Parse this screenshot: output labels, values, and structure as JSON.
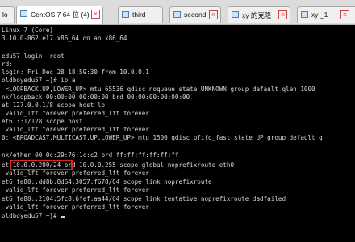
{
  "tabs": [
    {
      "label": "lo",
      "active": false
    },
    {
      "label": "CentOS 7 64 位 (4)",
      "active": true
    },
    {
      "label": "third",
      "active": false
    },
    {
      "label": "second",
      "active": false
    },
    {
      "label": "xy 的克隆",
      "active": false
    },
    {
      "label": "xy _1",
      "active": false
    }
  ],
  "tab_close_glyph": "×",
  "terminal": {
    "lines": [
      "Linux 7 (Core)",
      "3.10.0-862.el7.x86_64 on an x86_64",
      "",
      "edu57 login: root",
      "rd:",
      "login: Fri Dec 28 18:59:30 from 10.0.0.1",
      "oldboyedu57 ~]# ip a",
      " <LOOPBACK,UP,LOWER_UP> mtu 65536 qdisc noqueue state UNKNOWN group default qlen 1000",
      "nk/loopback 00:00:00:00:00:00 brd 00:00:00:00:00:00",
      "et 127.0.0.1/8 scope host lo",
      " valid_lft forever preferred_lft forever",
      "et6 ::1/128 scope host",
      " valid_lft forever preferred_lft forever",
      "0: <BROADCAST,MULTICAST,UP,LOWER_UP> mtu 1500 qdisc pfifo_fast state UP group default q",
      "",
      "nk/ether 00:0c:29:76:1c:c2 brd ff:ff:ff:ff:ff:ff",
      "et 10.0.0.200/24 brd 10.0.0.255 scope global noprefixroute eth0",
      " valid_lft forever preferred_lft forever",
      "et6 fe80::dd8b:8d64:3057:f678/64 scope link noprefixroute",
      " valid_lft forever preferred_lft forever",
      "et6 fe80::2104:5fc8:6fef:aa44/64 scope link tentative noprefixroute dadfailed",
      " valid_lft forever preferred_lft forever",
      "oldboyedu57 ~]# "
    ],
    "highlighted_text": "10.0.0.200/24",
    "highlight_color": "#e02424",
    "foreground_color": "#d6d6d6",
    "background_color": "#000000"
  }
}
